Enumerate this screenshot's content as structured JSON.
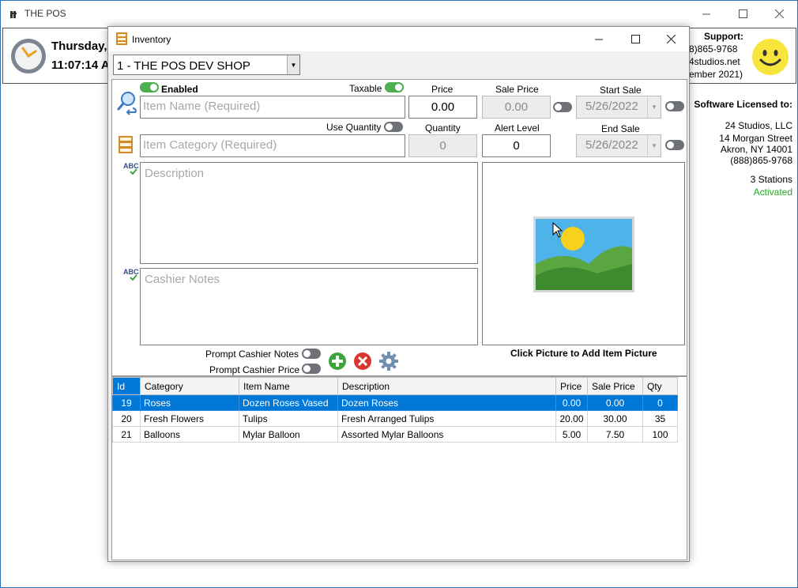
{
  "app": {
    "title": "THE POS"
  },
  "header": {
    "date": "Thursday,",
    "time": "11:07:14 A",
    "support_label": "Support:",
    "support_lines": [
      "8)865-9768",
      "4studios.net",
      "ember 2021)"
    ]
  },
  "license": {
    "title": "Software Licensed to:",
    "lines": [
      "24 Studios, LLC",
      "14 Morgan Street",
      "Akron, NY 14001",
      "(888)865-9768"
    ],
    "stations": "3 Stations",
    "status": "Activated",
    "status_color": "#22aa22"
  },
  "inventory": {
    "title": "Inventory",
    "shop": "1 - THE POS DEV SHOP",
    "enabled_label": "Enabled",
    "taxable_label": "Taxable",
    "price_label": "Price",
    "price_value": "0.00",
    "sale_price_label": "Sale Price",
    "sale_price_value": "0.00",
    "start_sale_label": "Start Sale",
    "start_sale_value": "5/26/2022",
    "end_sale_label": "End Sale",
    "end_sale_value": "5/26/2022",
    "item_name_placeholder": "Item Name (Required)",
    "use_quantity_label": "Use Quantity",
    "quantity_label": "Quantity",
    "quantity_value": "0",
    "alert_level_label": "Alert Level",
    "alert_level_value": "0",
    "item_category_placeholder": "Item Category (Required)",
    "description_placeholder": "Description",
    "cashier_notes_placeholder": "Cashier Notes",
    "picture_label": "Click Picture to Add Item Picture",
    "prompt_notes_label": "Prompt Cashier Notes",
    "prompt_price_label": "Prompt Cashier Price",
    "abc_label": "ABC",
    "grid": {
      "headers": [
        "Id",
        "Category",
        "Item Name",
        "Description",
        "Price",
        "Sale Price",
        "Qty"
      ],
      "rows": [
        [
          "19",
          "Roses",
          "Dozen Roses Vased",
          "Dozen Roses",
          "0.00",
          "0.00",
          "0"
        ],
        [
          "20",
          "Fresh Flowers",
          "Tulips",
          "Fresh Arranged Tulips",
          "20.00",
          "30.00",
          "35"
        ],
        [
          "21",
          "Balloons",
          "Mylar Balloon",
          "Assorted Mylar Balloons",
          "5.00",
          "7.50",
          "100"
        ]
      ],
      "selected_row": 0
    }
  },
  "colors": {
    "accent": "#0078d7",
    "toggle_on": "#4caf50",
    "add_button": "#3aa53a",
    "delete_button": "#d9362f"
  }
}
